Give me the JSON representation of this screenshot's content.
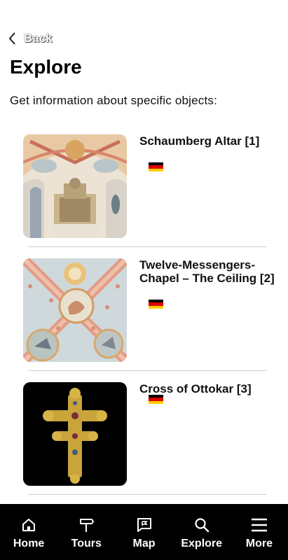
{
  "header": {
    "back_label": "Back",
    "title": "Explore",
    "subtitle": "Get information about specific objects:"
  },
  "items": [
    {
      "title": "Schaumberg Altar [1]",
      "language_flag": "german-flag-icon"
    },
    {
      "title": "Twelve-Messengers-Chapel – The Ceiling [2]",
      "language_flag": "german-flag-icon"
    },
    {
      "title": "Cross of Ottokar [3]",
      "language_flag": "german-flag-icon"
    }
  ],
  "nav": {
    "items": [
      {
        "label": "Home",
        "icon": "home-icon"
      },
      {
        "label": "Tours",
        "icon": "signpost-icon"
      },
      {
        "label": "Map",
        "icon": "map-flag-icon"
      },
      {
        "label": "Explore",
        "icon": "search-icon"
      },
      {
        "label": "More",
        "icon": "menu-icon"
      }
    ]
  },
  "colors": {
    "nav_background": "#000000",
    "flag_black": "#000000",
    "flag_red": "#dd0000",
    "flag_gold": "#ffce00"
  }
}
